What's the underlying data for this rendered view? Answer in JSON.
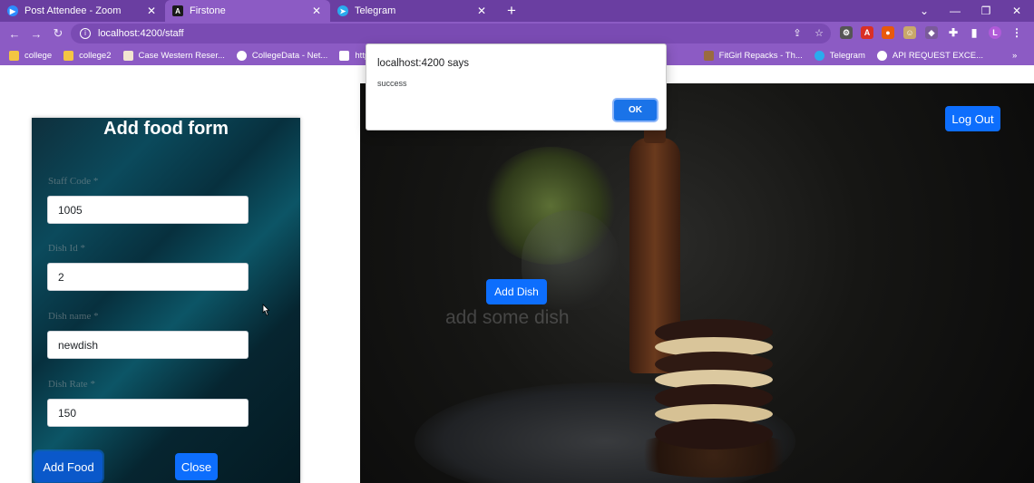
{
  "browser": {
    "tabs": [
      {
        "label": "Post Attendee - Zoom",
        "icon": "zoom-icon",
        "color": "#2d8cff"
      },
      {
        "label": "Firstone",
        "icon": "angular-icon",
        "color": "#dd0031"
      },
      {
        "label": "Telegram",
        "icon": "telegram-icon",
        "color": "#2aabee"
      }
    ],
    "url": "localhost:4200/staff",
    "bookmarks": [
      {
        "label": "college",
        "color": "#f4c542"
      },
      {
        "label": "college2",
        "color": "#f4c542"
      },
      {
        "label": "Case Western Reser...",
        "color": "#f2e6d0"
      },
      {
        "label": "CollegeData - Net...",
        "color": "#ffffff"
      },
      {
        "label": "https://v",
        "color": "#ffffff"
      },
      {
        "label": "FitGirl Repacks - Th...",
        "color": "#9a6b3f"
      },
      {
        "label": "Telegram",
        "color": "#2aabee"
      },
      {
        "label": "API REQUEST EXCE...",
        "color": "#ffffff"
      }
    ],
    "more_bookmarks": "»",
    "profile_initial": "L"
  },
  "form": {
    "title": "Add food form",
    "fields": [
      {
        "label": "Staff Code *",
        "value": "1005"
      },
      {
        "label": "Dish Id *",
        "value": "2"
      },
      {
        "label": "Dish name *",
        "value": "newdish"
      },
      {
        "label": "Dish Rate *",
        "value": "150"
      }
    ],
    "add_button": "Add Food",
    "close_button": "Close"
  },
  "hero": {
    "logout_button": "Log Out",
    "add_dish_button": "Add Dish",
    "hint_text": "add some dish"
  },
  "alert": {
    "title": "localhost:4200 says",
    "message": "success",
    "ok_button": "OK"
  },
  "colors": {
    "browser_frame": "#6a3ea1",
    "primary_button": "#0d6efd",
    "alert_ok": "#1a73e8"
  }
}
